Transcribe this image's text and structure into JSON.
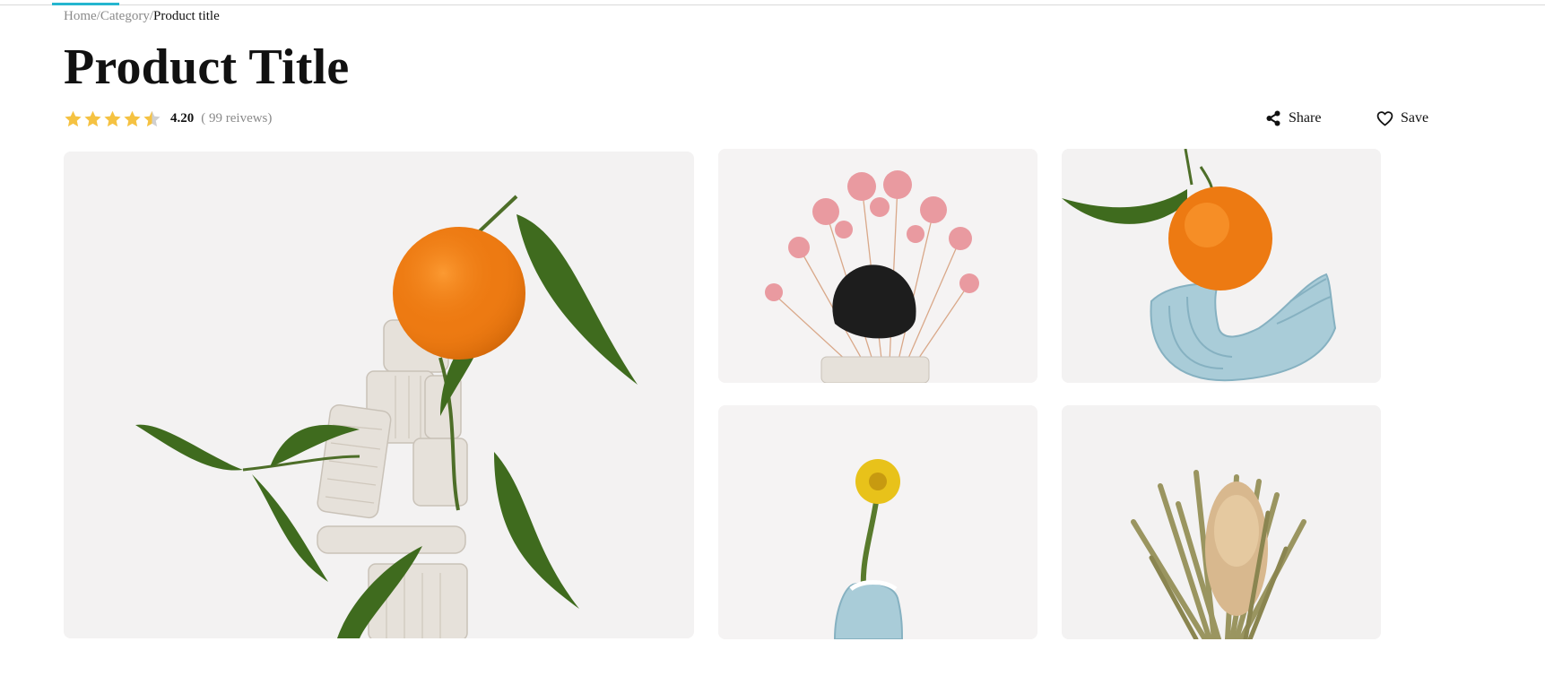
{
  "breadcrumb": {
    "items": [
      "Home",
      "Category"
    ],
    "separator": "/",
    "current": "Product title"
  },
  "product": {
    "title": "Product Title",
    "rating": {
      "value": "4.20",
      "count_text": "( 99 reivews)",
      "stars_filled": 4.5,
      "stars_max": 5,
      "star_color": "#f5c242",
      "star_empty_color": "#d0d0d0"
    }
  },
  "actions": {
    "share_label": "Share",
    "share_icon": "share-icon",
    "save_label": "Save",
    "save_icon": "heart-icon"
  },
  "gallery": {
    "images": [
      {
        "role": "main",
        "subject": "orange-on-clay-sculpture"
      },
      {
        "role": "thumb",
        "subject": "dried-pink-flowers-black-rock"
      },
      {
        "role": "thumb",
        "subject": "orange-on-blue-clay"
      },
      {
        "role": "thumb",
        "subject": "yellow-flower-in-blue-vase"
      },
      {
        "role": "thumb",
        "subject": "dried-banksia"
      }
    ],
    "background_color": "#f3f2f2"
  },
  "accent_color": "#25b6cf"
}
